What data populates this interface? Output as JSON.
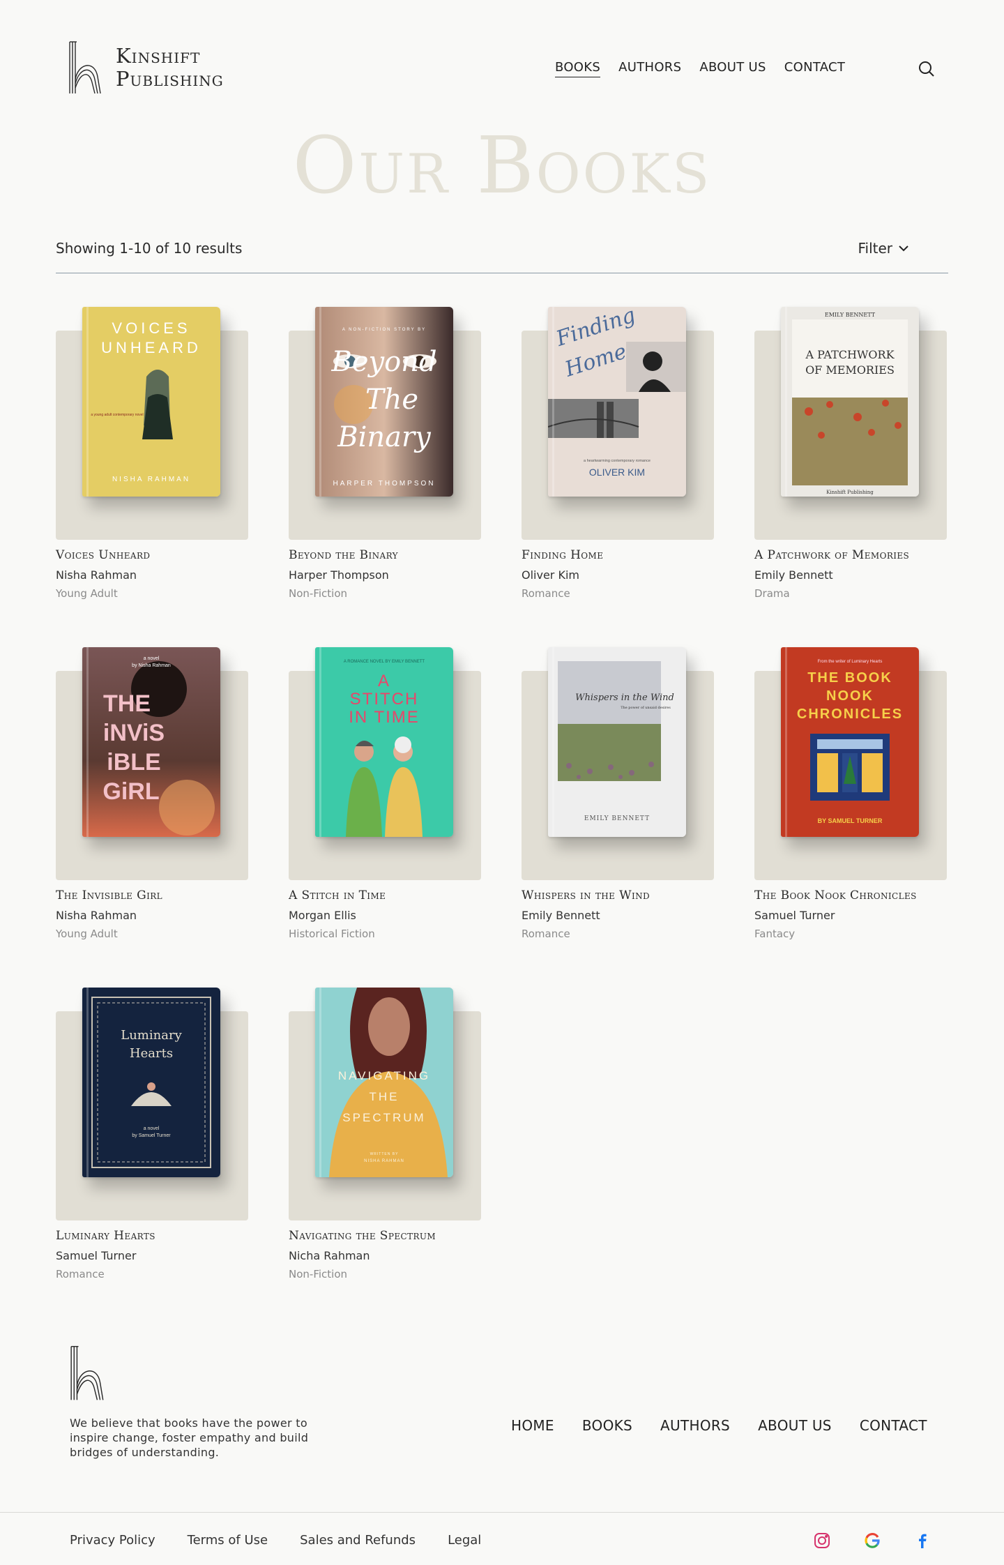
{
  "brand": {
    "line1": "Kinshift",
    "line2": "Publishing"
  },
  "nav": [
    {
      "label": "BOOKS",
      "active": true
    },
    {
      "label": "AUTHORS",
      "active": false
    },
    {
      "label": "ABOUT US",
      "active": false
    },
    {
      "label": "CONTACT",
      "active": false
    }
  ],
  "page_title": "Our Books",
  "results": {
    "text": "Showing 1-10 of 10 results",
    "filter_label": "Filter"
  },
  "books": [
    {
      "title": "Voices Unheard",
      "author": "Nisha Rahman",
      "genre": "Young Adult",
      "cover": {
        "title_lines": [
          "VOICES",
          "UNHEARD"
        ],
        "author": "NISHA RAHMAN",
        "tagline": "a young adult contemporary novel",
        "bg": "#e4cd64"
      }
    },
    {
      "title": "Beyond the Binary",
      "author": "Harper Thompson",
      "genre": "Non-Fiction",
      "cover": {
        "title_lines": [
          "Beyond",
          "The",
          "Binary"
        ],
        "author": "HARPER THOMPSON",
        "tagline": "A NON-FICTION STORY BY",
        "bg": "#8a6a60"
      }
    },
    {
      "title": "Finding Home",
      "author": "Oliver Kim",
      "genre": "Romance",
      "cover": {
        "title_lines": [
          "Finding",
          "Home"
        ],
        "author": "OLIVER KIM",
        "tagline": "a heartwarming contemporary romance",
        "bg": "#e8ddd6"
      }
    },
    {
      "title": "A Patchwork of Memories",
      "author": "Emily Bennett",
      "genre": "Drama",
      "cover": {
        "title_lines": [
          "A PATCHWORK",
          "OF MEMORIES"
        ],
        "author": "EMILY BENNETT",
        "tagline": "Kinshift Publishing",
        "bg": "#ebe9e4"
      }
    },
    {
      "title": "The Invisible Girl",
      "author": "Nisha Rahman",
      "genre": "Young Adult",
      "cover": {
        "title_lines": [
          "THE",
          "iNViS",
          "iBLE",
          "GiRL"
        ],
        "author": "by Nisha Rahman",
        "tagline": "a novel",
        "bg": "#6b4a48"
      }
    },
    {
      "title": "A Stitch in Time",
      "author": "Morgan Ellis",
      "genre": "Historical Fiction",
      "cover": {
        "title_lines": [
          "A",
          "STITCH",
          "IN TIME"
        ],
        "author": "A ROMANCE NOVEL BY EMILY BENNETT",
        "tagline": "",
        "bg": "#3ccaa8"
      }
    },
    {
      "title": "Whispers in the Wind",
      "author": "Emily Bennett",
      "genre": "Romance",
      "cover": {
        "title_lines": [
          "Whispers in the Wind"
        ],
        "author": "EMILY BENNETT",
        "tagline": "The power of unsaid desires",
        "bg": "#eeeeee"
      }
    },
    {
      "title": "The Book Nook Chronicles",
      "author": "Samuel Turner",
      "genre": "Fantacy",
      "cover": {
        "title_lines": [
          "THE BOOK",
          "NOOK",
          "CHRONICLES"
        ],
        "author": "BY SAMUEL TURNER",
        "tagline": "From the writer of Luminary Hearts",
        "bg": "#c23a22"
      }
    },
    {
      "title": "Luminary Hearts",
      "author": "Samuel Turner",
      "genre": "Romance",
      "cover": {
        "title_lines": [
          "Luminary",
          "Hearts"
        ],
        "author": "by Samuel Turner",
        "tagline": "a novel",
        "bg": "#14233e"
      }
    },
    {
      "title": "Navigating the Spectrum",
      "author": "Nicha Rahman",
      "genre": "Non-Fiction",
      "cover": {
        "title_lines": [
          "NAVIGATING",
          "THE",
          "SPECTRUM"
        ],
        "author": "NISHA RAHMAN",
        "tagline": "WRITTEN BY",
        "bg": "#8fd2d0"
      }
    }
  ],
  "footer": {
    "tagline": "We believe that books have the power to inspire change, foster empathy and build bridges of understanding.",
    "nav": [
      "HOME",
      "BOOKS",
      "AUTHORS",
      "ABOUT US",
      "CONTACT"
    ],
    "legal": [
      "Privacy Policy",
      "Terms of Use",
      "Sales and Refunds",
      "Legal"
    ],
    "social": [
      "instagram-icon",
      "google-icon",
      "facebook-icon"
    ]
  }
}
